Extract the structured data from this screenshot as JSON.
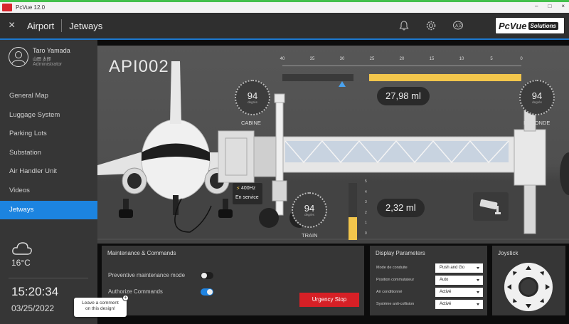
{
  "window": {
    "title": "PcVue 12.0",
    "minimize": "–",
    "maximize": "□",
    "close": "×"
  },
  "header": {
    "close_glyph": "×",
    "breadcrumb": [
      "Airport",
      "Jetways"
    ],
    "brand": "PcVue",
    "brand_suffix": "Solutions"
  },
  "user": {
    "name": "Taro Yamada",
    "name_jp": "山田 太郎",
    "role": "Administrator"
  },
  "nav": {
    "items": [
      {
        "label": "General Map"
      },
      {
        "label": "Luggage System"
      },
      {
        "label": "Parking Lots"
      },
      {
        "label": "Substation"
      },
      {
        "label": "Air Handler Unit"
      },
      {
        "label": "Videos"
      },
      {
        "label": "Jetways",
        "active": true
      }
    ]
  },
  "weather": {
    "icon": "cloud-icon",
    "temperature": "16°C"
  },
  "clock": {
    "time": "15:20:34",
    "date": "03/25/2022"
  },
  "scene": {
    "gate_name": "API002",
    "ruler": {
      "labels": [
        "40",
        "35",
        "30",
        "25",
        "20",
        "15",
        "10",
        "5",
        "0"
      ],
      "fill_from": 25.5,
      "fill_to": 0,
      "marker": 30
    },
    "gauges": [
      {
        "id": "cabine",
        "value": "94",
        "unit": "degrés",
        "label": "CABINE"
      },
      {
        "id": "rotonde",
        "value": "94",
        "unit": "degrés",
        "label": "ROTONDE"
      },
      {
        "id": "train",
        "value": "94",
        "unit": "degrés",
        "label": "TRAIN"
      }
    ],
    "distance_top": "27,98 ml",
    "distance_bottom": "2,32 ml",
    "power": {
      "icon": "lightning-icon",
      "frequency": "400Hz",
      "status": "En service"
    },
    "vertical_scale": {
      "labels": [
        "5",
        "4",
        "3",
        "2",
        "1",
        "0"
      ],
      "level": 2
    }
  },
  "maintenance": {
    "title": "Maintenance & Commands",
    "preventive_label": "Preventive maintenance mode",
    "preventive_on": false,
    "authorize_label": "Authorize Commands",
    "authorize_on": true,
    "urgency_label": "Urgency Stop"
  },
  "display_params": {
    "title": "Display Parameters",
    "rows": [
      {
        "label": "Mode de conduite",
        "value": "Push and Go"
      },
      {
        "label": "Position commutateur",
        "value": "Auto"
      },
      {
        "label": "Air conditionné",
        "value": "Activé"
      },
      {
        "label": "Système anti-collision",
        "value": "Activé"
      }
    ]
  },
  "joystick": {
    "title": "Joystick"
  },
  "tooltip": {
    "text_line1": "Leave a comment",
    "text_line2": "on this design!",
    "plus": "+"
  },
  "colors": {
    "accent": "#1c84e0",
    "warning": "#f3c64c",
    "danger": "#d62026"
  }
}
